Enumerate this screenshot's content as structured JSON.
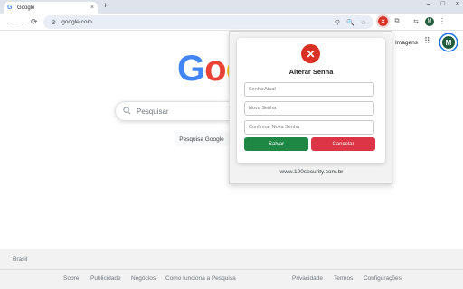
{
  "browser": {
    "tab": {
      "favicon": "G",
      "title": "Google",
      "close_icon": "×"
    },
    "new_tab_icon": "+",
    "window_controls": [
      "–",
      "□",
      "×"
    ],
    "nav": {
      "back": "←",
      "forward": "→",
      "reload": "⟳"
    },
    "omnibox": {
      "tune_icon": "⚙",
      "url": "google.com",
      "icons": [
        "⚲",
        "🔍",
        "☆"
      ]
    },
    "extensions": {
      "red_icon": "✕",
      "icons": [
        "⧉",
        "⇆"
      ],
      "profile": "M",
      "menu": "⋮"
    }
  },
  "google": {
    "images_link": "Imagens",
    "apps_icon": "⠿",
    "avatar": "M",
    "logo_letters": [
      "G",
      "o",
      "o"
    ],
    "search_placeholder": "Pesquisar",
    "search_button": "Pesquisa Google"
  },
  "footer": {
    "country": "Brasil",
    "links_left": [
      "Sobre",
      "Publicidade",
      "Negócios",
      "Como funciona a Pesquisa"
    ],
    "links_right": [
      "Privacidade",
      "Termos",
      "Configurações"
    ]
  },
  "popup": {
    "icon": "✕",
    "title": "Alterar Senha",
    "fields": [
      "Senha Atual",
      "Nova Senha",
      "Confirmar Nova Senha"
    ],
    "save_button": "Salvar",
    "cancel_button": "Cancelar",
    "footer_text": "www.100security.com.br"
  },
  "colors": {
    "accent_red": "#d93025",
    "save_green": "#1e8744",
    "cancel_red": "#dc3545"
  }
}
